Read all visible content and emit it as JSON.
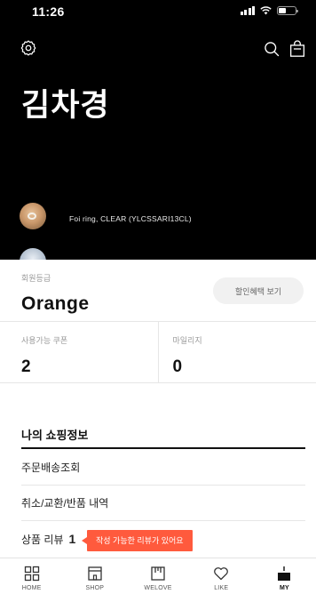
{
  "status_bar": {
    "time": "11:26"
  },
  "header": {
    "user_name": "김차경",
    "product_caption": "Foi ring, CLEAR (YLCSSARI13CL)"
  },
  "membership": {
    "grade_label": "회원등급",
    "grade_value": "Orange",
    "benefit_button": "할인혜택 보기"
  },
  "stats": [
    {
      "label": "사용가능 쿠폰",
      "value": "2"
    },
    {
      "label": "마일리지",
      "value": "0"
    }
  ],
  "shopping": {
    "title": "나의 쇼핑정보",
    "items": [
      {
        "label": "주문배송조회"
      },
      {
        "label": "취소/교환/반품 내역"
      },
      {
        "label": "상품 리뷰",
        "count": "1"
      }
    ],
    "review_tooltip": "작성 가능한 리뷰가 있어요"
  },
  "tabbar": {
    "items": [
      {
        "label": "HOME",
        "icon": "grid-icon"
      },
      {
        "label": "SHOP",
        "icon": "shop-icon"
      },
      {
        "label": "WELOVE",
        "icon": "welove-icon"
      },
      {
        "label": "LIKE",
        "icon": "heart-icon"
      },
      {
        "label": "MY",
        "icon": "my-icon",
        "active": true
      }
    ]
  },
  "colors": {
    "accent": "#ff5a3d",
    "hero_background": "#000000"
  }
}
